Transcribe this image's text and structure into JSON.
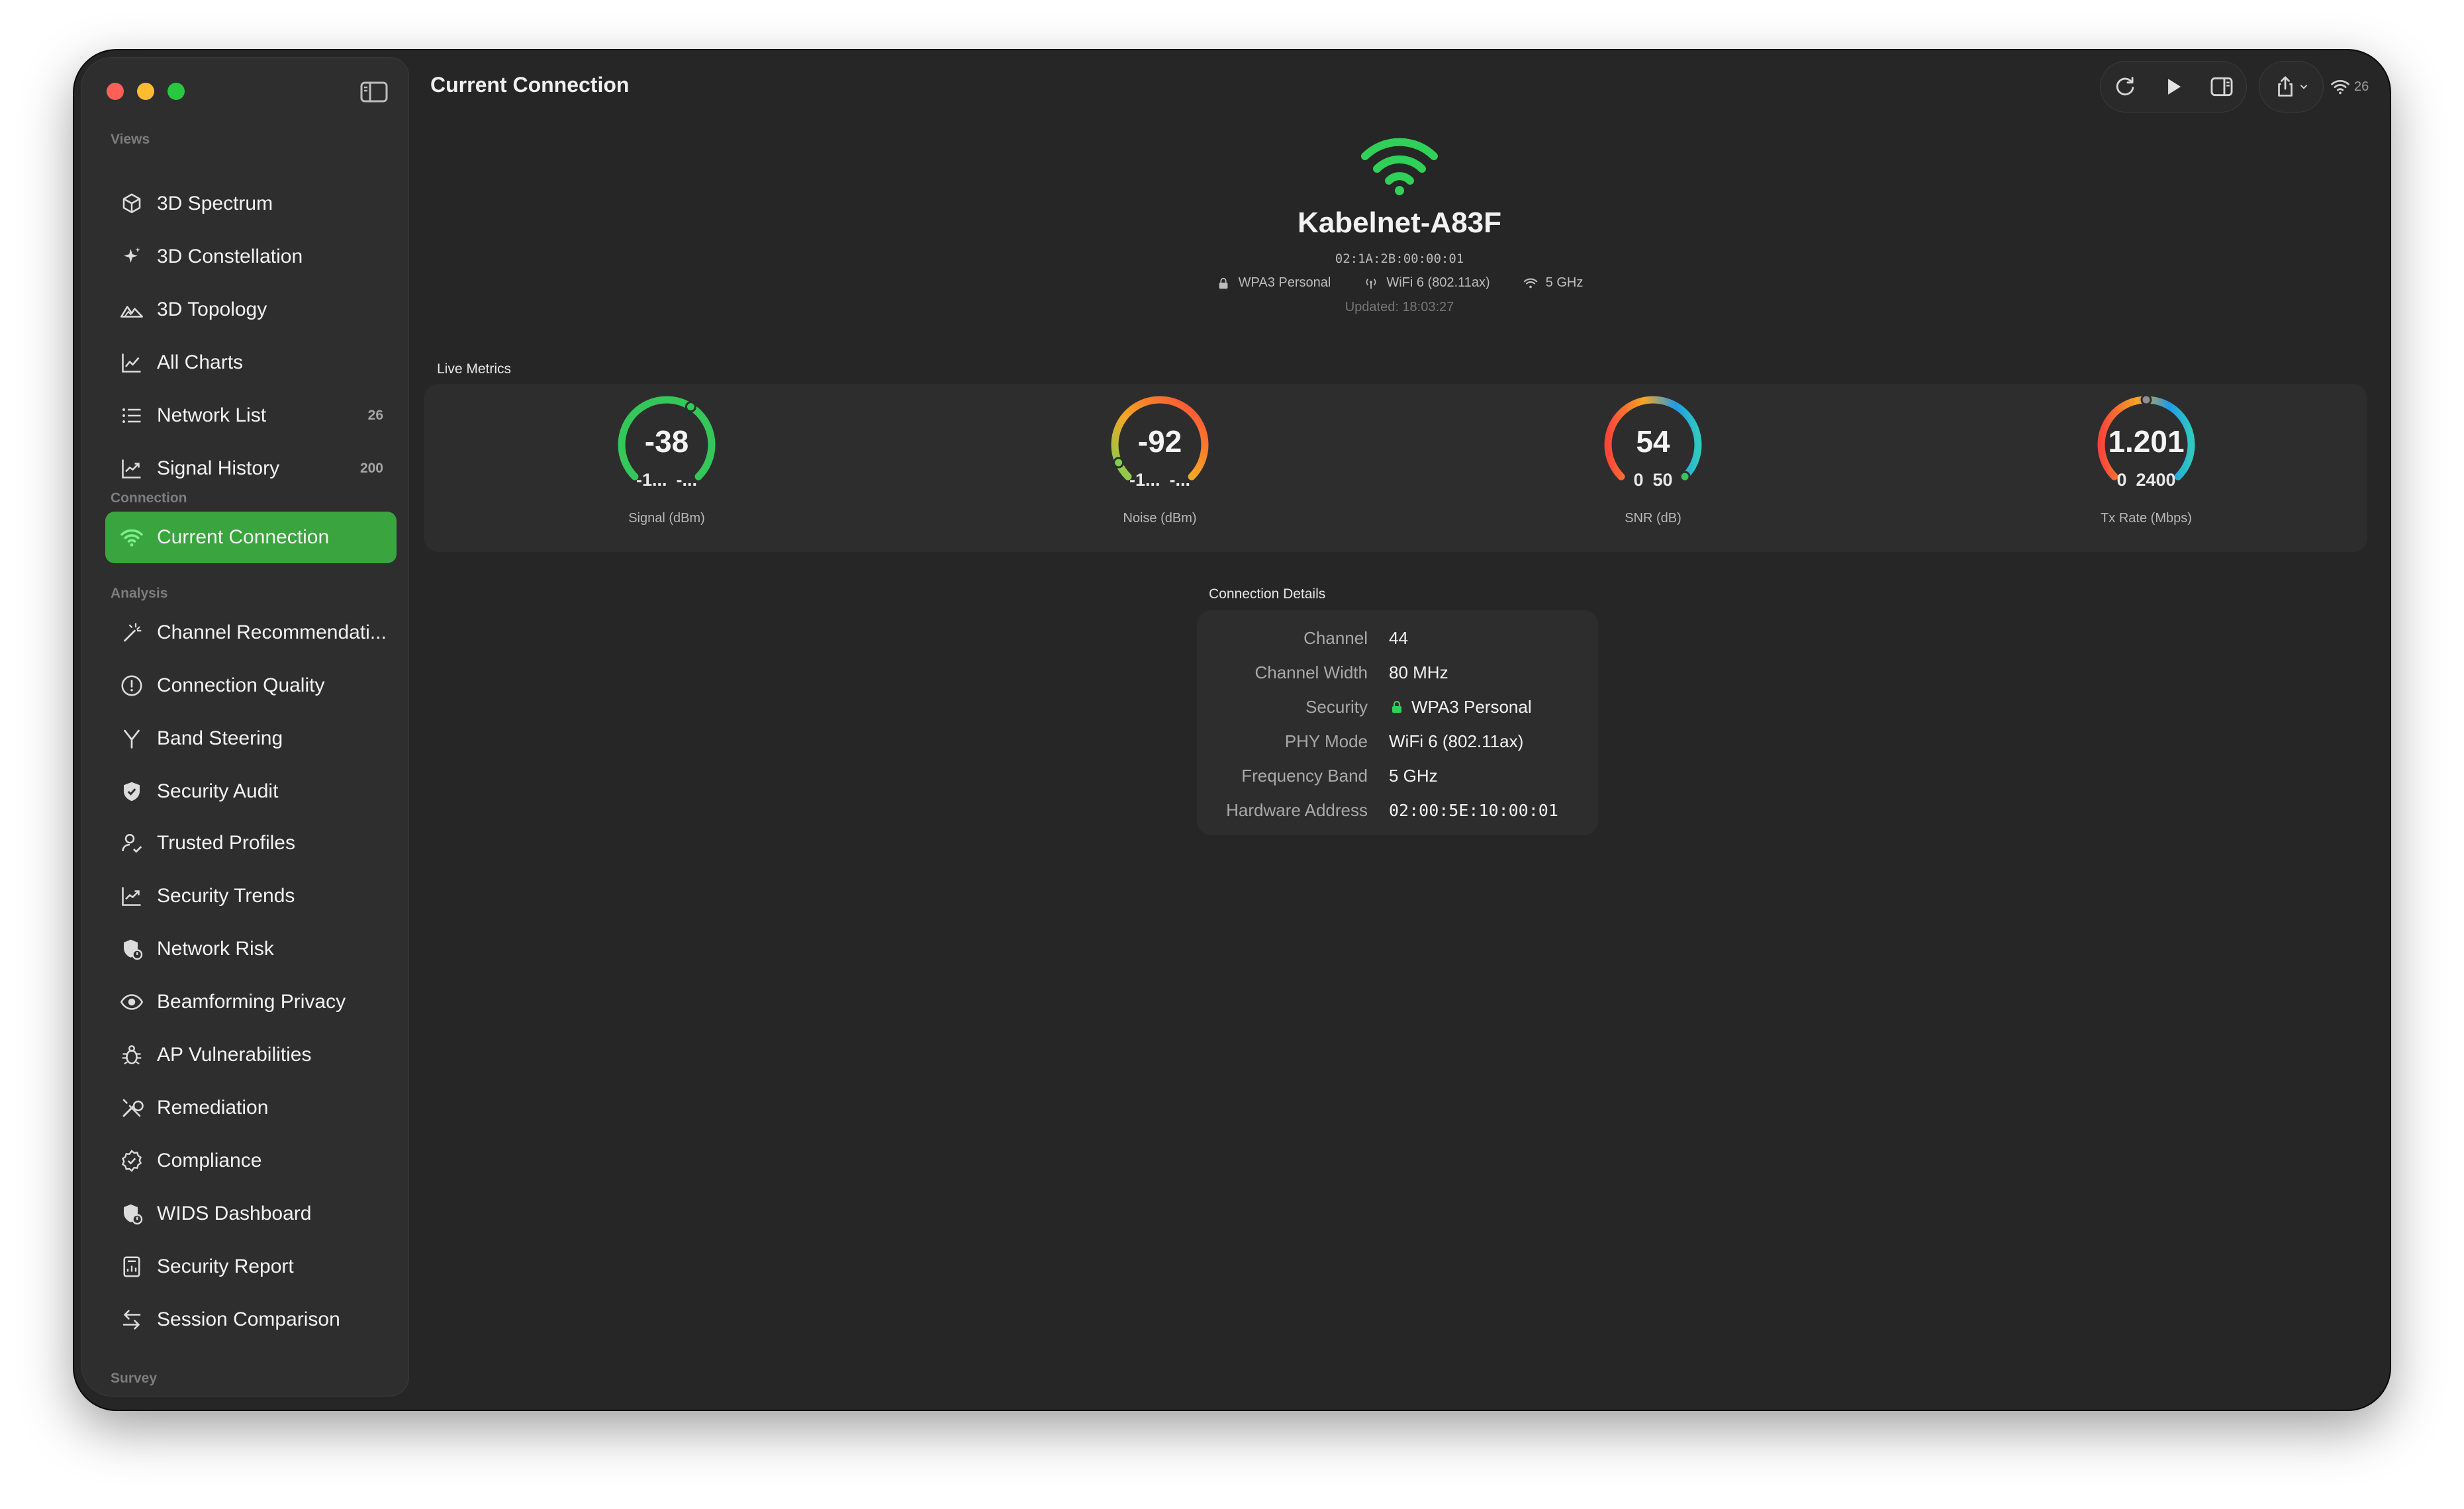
{
  "window": {
    "title": "Current Connection"
  },
  "sidebar": {
    "sections": {
      "views": "Views",
      "connection": "Connection",
      "analysis": "Analysis",
      "survey": "Survey"
    },
    "items": [
      {
        "label": "3D Spectrum",
        "icon": "cube-icon",
        "badge": ""
      },
      {
        "label": "3D Constellation",
        "icon": "sparkles-icon",
        "badge": ""
      },
      {
        "label": "3D Topology",
        "icon": "mountains-icon",
        "badge": ""
      },
      {
        "label": "All Charts",
        "icon": "line-chart-icon",
        "badge": ""
      },
      {
        "label": "Network List",
        "icon": "list-icon",
        "badge": "26"
      },
      {
        "label": "Signal History",
        "icon": "trend-chart-icon",
        "badge": "200"
      },
      {
        "label": "Current Connection",
        "icon": "wifi-icon",
        "badge": "",
        "active": true
      },
      {
        "label": "Channel Recommendati...",
        "icon": "magic-wand-icon",
        "badge": ""
      },
      {
        "label": "Connection Quality",
        "icon": "gauge-icon",
        "badge": ""
      },
      {
        "label": "Band Steering",
        "icon": "fork-icon",
        "badge": ""
      },
      {
        "label": "Security Audit",
        "icon": "shield-check-icon",
        "badge": ""
      },
      {
        "label": "Trusted Profiles",
        "icon": "person-check-icon",
        "badge": ""
      },
      {
        "label": "Security Trends",
        "icon": "trend-chart-icon",
        "badge": ""
      },
      {
        "label": "Network Risk",
        "icon": "shield-alert-icon",
        "badge": ""
      },
      {
        "label": "Beamforming Privacy",
        "icon": "eye-icon",
        "badge": ""
      },
      {
        "label": "AP Vulnerabilities",
        "icon": "ant-icon",
        "badge": ""
      },
      {
        "label": "Remediation",
        "icon": "wrench-icon",
        "badge": ""
      },
      {
        "label": "Compliance",
        "icon": "checkmark-seal-icon",
        "badge": ""
      },
      {
        "label": "WIDS Dashboard",
        "icon": "shield-alert-icon",
        "badge": ""
      },
      {
        "label": "Security Report",
        "icon": "report-icon",
        "badge": ""
      },
      {
        "label": "Session Comparison",
        "icon": "arrows-swap-icon",
        "badge": ""
      }
    ]
  },
  "toolbar": {
    "wifi_count": "26"
  },
  "network": {
    "ssid": "Kabelnet-A83F",
    "bssid": "02:1A:2B:00:00:01",
    "security": "WPA3 Personal",
    "phy": "WiFi 6 (802.11ax)",
    "band": "5 GHz",
    "updated": "Updated: 18:03:27"
  },
  "live_metrics": {
    "label": "Live Metrics",
    "gauges": [
      {
        "value": "-38",
        "min": "-1...",
        "max": "-...",
        "caption": "Signal (dBm)",
        "fraction": 0.62
      },
      {
        "value": "-92",
        "min": "-1...",
        "max": "-...",
        "caption": "Noise (dBm)",
        "fraction": 0.08
      },
      {
        "value": "54",
        "min": "0",
        "max": "50",
        "caption": "SNR (dB)",
        "fraction": 1.0
      },
      {
        "value": "1.201",
        "min": "0",
        "max": "2400",
        "caption": "Tx Rate (Mbps)",
        "fraction": 0.5
      }
    ]
  },
  "details": {
    "label": "Connection Details",
    "rows": [
      {
        "key": "Channel",
        "value": "44"
      },
      {
        "key": "Channel Width",
        "value": "80 MHz"
      },
      {
        "key": "Security",
        "value": "WPA3 Personal"
      },
      {
        "key": "PHY Mode",
        "value": "WiFi 6 (802.11ax)"
      },
      {
        "key": "Frequency Band",
        "value": "5 GHz"
      },
      {
        "key": "Hardware Address",
        "value": "02:00:5E:10:00:01"
      }
    ]
  },
  "colors": {
    "accent": "#3aa53f",
    "wifi_green": "#30d158",
    "background": "#262626"
  }
}
